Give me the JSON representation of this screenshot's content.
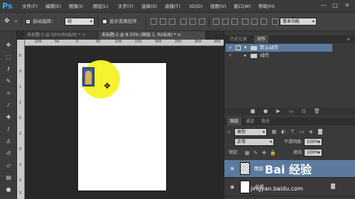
{
  "app": {
    "logo": "Ps"
  },
  "menu": [
    "文件(F)",
    "编辑(E)",
    "图像(I)",
    "图层(L)",
    "文字(Y)",
    "选择(S)",
    "滤镜(T)",
    "3D(D)",
    "视图(V)",
    "窗口(W)",
    "帮助(H)"
  ],
  "window_controls": {
    "minimize": "—",
    "restore": "□",
    "close": "✕"
  },
  "options": {
    "auto_select_label": "自动选择：",
    "auto_select_checked": true,
    "auto_select_value": "组",
    "transform_label": "显示变换控件",
    "workspace": "基本功能"
  },
  "tabs": [
    {
      "label": "未标题-1 @ 50%(RGB/8) *",
      "close": "×",
      "active": false
    },
    {
      "label": "未标题-2 @ 8.33% (图层 1, RGB/8) *",
      "close": "×",
      "active": true
    }
  ],
  "ruler": {
    "h_labels": [
      "100",
      "50",
      "0",
      "50",
      "100",
      "150",
      "200",
      "250",
      "300",
      "350"
    ],
    "v_labels": [
      "0",
      "5",
      "1",
      "1",
      "5",
      "2",
      "0",
      "2",
      "5",
      "3"
    ]
  },
  "history_panel": {
    "tabs": [
      "历史记录",
      "动作"
    ],
    "rows": [
      {
        "label": "默认动作",
        "checked": true
      },
      {
        "label": "动作",
        "checked": true
      }
    ]
  },
  "layers_panel": {
    "tabs": [
      "图层",
      "通道",
      "路径"
    ],
    "filter_type": "类型",
    "blend_mode": "正常",
    "opacity_label": "不透明度:",
    "opacity_value": "100%",
    "lock_label": "锁定:",
    "fill_label": "填充:",
    "fill_value": "100%",
    "layers": [
      {
        "name": "图层 1",
        "selected": true
      },
      {
        "name": "背景",
        "selected": false
      }
    ]
  },
  "watermark": {
    "site": "jingyan.baidu.com",
    "brand": "Bai 经验"
  },
  "colors": {
    "accent": "#3fa9f5",
    "highlight": "#f5f230",
    "selected_row": "#5c7a9e"
  }
}
